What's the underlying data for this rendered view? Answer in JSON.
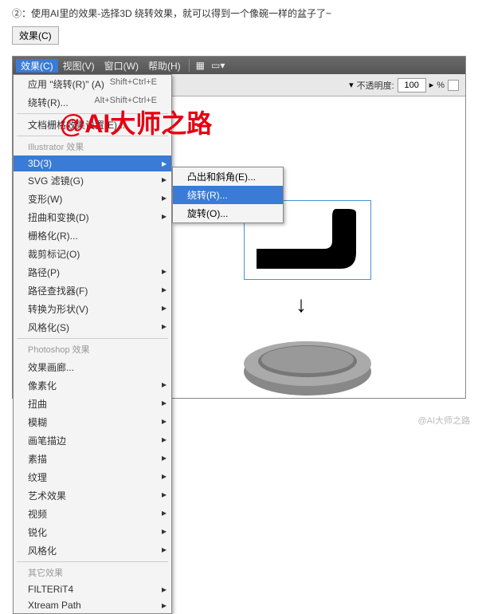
{
  "header": {
    "instruction": "②：使用AI里的效果-选择3D 绕转效果，就可以得到一个像碗一样的盆子了~",
    "effect_button": "效果(C)"
  },
  "menubar": {
    "items": [
      "效果(C)",
      "视图(V)",
      "窗口(W)",
      "帮助(H)"
    ]
  },
  "toolbar": {
    "opacity_label": "不透明度:",
    "opacity_value": "100",
    "percent": "%"
  },
  "dropdown": {
    "apply": "应用 \"绕转(R)\" (A)",
    "apply_shortcut": "Shift+Ctrl+E",
    "revolve": "绕转(R)...",
    "revolve_shortcut": "Alt+Shift+Ctrl+E",
    "doc_raster": "文档栅格效果设置(E)...",
    "section_illustrator": "Illustrator 效果",
    "items_ai": [
      "3D(3)",
      "SVG 滤镜(G)",
      "变形(W)",
      "扭曲和变换(D)",
      "栅格化(R)...",
      "裁剪标记(O)",
      "路径(P)",
      "路径查找器(F)",
      "转换为形状(V)",
      "风格化(S)"
    ],
    "section_ps": "Photoshop 效果",
    "items_ps": [
      "效果画廊...",
      "像素化",
      "扭曲",
      "模糊",
      "画笔描边",
      "素描",
      "纹理",
      "艺术效果",
      "视频",
      "锐化",
      "风格化"
    ],
    "section_other": "其它效果",
    "items_other": [
      "FILTERiT4",
      "Xtream Path"
    ]
  },
  "submenu": {
    "items": [
      "凸出和斜角(E)...",
      "绕转(R)...",
      "旋转(O)..."
    ]
  },
  "watermark": "@AI大师之路",
  "credit": "@AI大师之路"
}
